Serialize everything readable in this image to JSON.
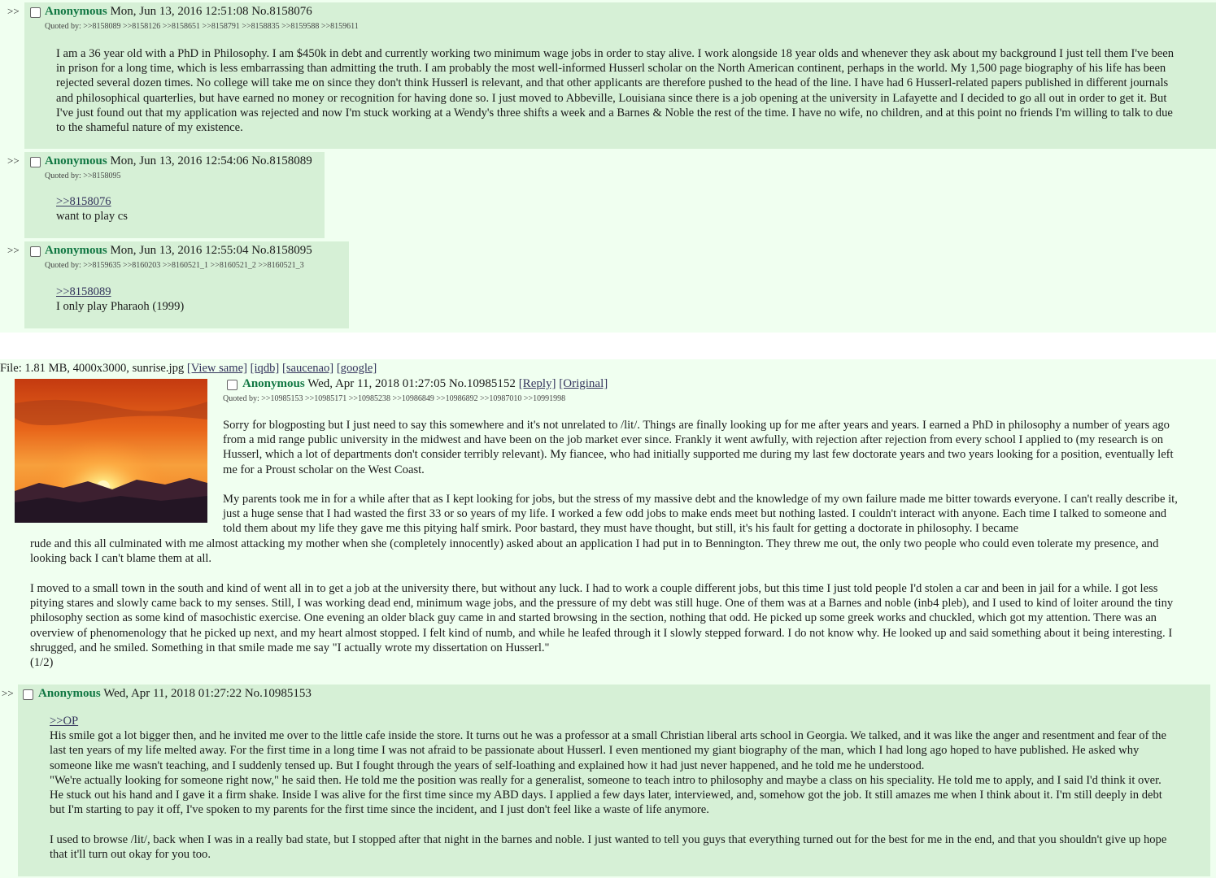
{
  "threads": [
    {
      "post": {
        "arrows": ">>",
        "name": "Anonymous",
        "datetime": "Mon, Jun 13, 2016 12:51:08",
        "number": "No.8158076",
        "quoted_by": "Quoted by: >>8158089 >>8158126 >>8158651 >>8158791 >>8158835 >>8159588 >>8159611",
        "body": "I am a 36 year old with a PhD in Philosophy. I am $450k in debt and currently working two minimum wage jobs in order to stay alive. I work alongside 18 year olds and whenever they ask about my background I just tell them I've been in prison for a long time, which is less embarrassing than admitting the truth. I am probably the most well-informed Husserl scholar on the North American continent, perhaps in the world. My 1,500 page biography of his life has been rejected several dozen times. No college will take me on since they don't think Husserl is relevant, and that other applicants are therefore pushed to the head of the line. I have had 6 Husserl-related papers published in different journals and philosophical quarterlies, but have earned no money or recognition for having done so. I just moved to Abbeville, Louisiana since there is a job opening at the university in Lafayette and I decided to go all out in order to get it. But I've just found out that my application was rejected and now I'm stuck working at a Wendy's three shifts a week and a Barnes & Noble the rest of the time. I have no wife, no children, and at this point no friends I'm willing to talk to due to the shameful nature of my existence."
      },
      "reply1": {
        "arrows": ">>",
        "name": "Anonymous",
        "datetime": "Mon, Jun 13, 2016 12:54:06",
        "number": "No.8158089",
        "quoted_by": "Quoted by: >>8158095",
        "quote_link": ">>8158076",
        "text": "want to play cs"
      },
      "reply2": {
        "arrows": ">>",
        "name": "Anonymous",
        "datetime": "Mon, Jun 13, 2016 12:55:04",
        "number": "No.8158095",
        "quoted_by": "Quoted by: >>8159635 >>8160203 >>8160521_1 >>8160521_2 >>8160521_3",
        "quote_link": ">>8158089",
        "text": "I only play Pharaoh (1999)"
      }
    },
    {
      "file": {
        "info": "File: 1.81 MB, 4000x3000, sunrise.jpg",
        "view_same": "[View same]",
        "iqdb": "[iqdb]",
        "saucenao": "[saucenao]",
        "google": "[google]"
      },
      "op": {
        "name": "Anonymous",
        "datetime": "Wed, Apr 11, 2018 01:27:05",
        "number": "No.10985152",
        "reply_link": "[Reply]",
        "original_link": "[Original]",
        "quoted_by": "Quoted by: >>10985153 >>10985171 >>10985238 >>10986849 >>10986892 >>10987010 >>10991998",
        "para1": "Sorry for blogposting but I just need to say this somewhere and it's not unrelated to /lit/. Things are finally looking up for me after years and years. I earned a PhD in philosophy a number of years ago from a mid range public university in the midwest and have been on the job market ever since. Frankly it went awfully, with rejection after rejection from every school I applied to (my research is on Husserl, which a lot of departments don't consider terribly relevant). My fiancee, who had initially supported me during my last few doctorate years and two years looking for a position, eventually left me for a Proust scholar on the West Coast.",
        "para2a": "My parents took me in for a while after that as I kept looking for jobs, but the stress of my massive debt and the knowledge of my own failure made me bitter towards everyone. I can't really describe it, just a huge sense that I had wasted the first 33 or so years of my life. I worked a few odd jobs to make ends meet but nothing lasted. I couldn't interact with anyone. Each time I talked to someone and told them about my life they gave me this pitying half smirk. Poor bastard, they must have thought, but still, it's his fault for getting a doctorate in philosophy. I became",
        "para2b": "rude and this all culminated with me almost attacking my mother when she (completely innocently) asked about an application I had put in to Bennington. They threw me out, the only two people who could even tolerate my presence, and looking back I can't blame them at all.",
        "para3": "I moved to a small town in the south and kind of went all in to get a job at the university there, but without any luck. I had to work a couple different jobs, but this time I just told people I'd stolen a car and been in jail for a while. I got less pitying stares and slowly came back to my senses. Still, I was working dead end, minimum wage jobs, and the pressure of my debt was still huge. One of them was at a Barnes and noble (inb4 pleb), and I used to kind of loiter around the tiny philosophy section as some kind of masochistic exercise. One evening an older black guy came in and started browsing in the section, nothing that odd. He picked up some greek works and chuckled, which got my attention. There was an overview of phenomenology that he picked up next, and my heart almost stopped. I felt kind of numb, and while he leafed through it I slowly stepped forward. I do not know why. He looked up and said something about it being interesting. I shrugged, and he smiled. Something in that smile made me say \"I actually wrote my dissertation on Husserl.\"",
        "page_marker": "(1/2)"
      },
      "reply": {
        "arrows": ">>",
        "name": "Anonymous",
        "datetime": "Wed, Apr 11, 2018 01:27:22",
        "number": "No.10985153",
        "quote_link": ">>OP",
        "para1": "His smile got a lot bigger then, and he invited me over to the little cafe inside the store. It turns out he was a professor at a small Christian liberal arts school in Georgia. We talked, and it was like the anger and resentment and fear of the last ten years of my life melted away. For the first time in a long time I was not afraid to be passionate about Husserl. I even mentioned my giant biography of the man, which I had long ago hoped to have published. He asked why someone like me wasn't teaching, and I suddenly tensed up. But I fought through the years of self-loathing and explained how it had just never happened, and he told me he understood.",
        "para2": "\"We're actually looking for someone right now,\" he said then. He told me the position was really for a generalist, someone to teach intro to philosophy and maybe a class on his speciality. He told me to apply, and I said I'd think it over. He stuck out his hand and I gave it a firm shake. Inside I was alive for the first time since my ABD days. I applied a few days later, interviewed, and, somehow got the job. It still amazes me when I think about it. I'm still deeply in debt but I'm starting to pay it off, I've spoken to my parents for the first time since the incident, and I just don't feel like a waste of life anymore.",
        "para3": "I used to browse /lit/, back when I was in a really bad state, but I stopped after that night in the barnes and noble. I just wanted to tell you guys that everything turned out for the best for me in the end, and that you shouldn't give up hope that it'll turn out okay for you too."
      }
    }
  ],
  "colors": {
    "background": "#f0fff0",
    "post_background": "#d6f0d6",
    "name_green": "#117743",
    "link_blue": "#34345c"
  }
}
